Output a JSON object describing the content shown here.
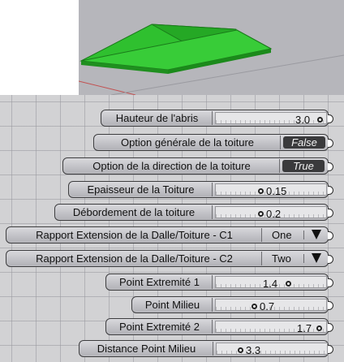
{
  "viewport": {
    "roof_color": "#2ec82e",
    "background": "#b6b6bb"
  },
  "params": [
    {
      "type": "slider",
      "label": "Hauteur de l'abris",
      "value": "3.0",
      "fraction": 0.95
    },
    {
      "type": "toggle",
      "label": "Option générale de la toiture",
      "value": "False"
    },
    {
      "type": "toggle",
      "label": "Option de la direction de la toiture",
      "value": "True"
    },
    {
      "type": "slider",
      "label": "Epaisseur de la Toiture",
      "value": "0.15",
      "fraction": 0.3
    },
    {
      "type": "slider",
      "label": "Débordement de la toiture",
      "value": "0.2",
      "fraction": 0.35
    },
    {
      "type": "dropdown",
      "label": "Rapport Extension de la Dalle/Toiture - C1",
      "value": "One"
    },
    {
      "type": "dropdown",
      "label": "Rapport Extension de la Dalle/Toiture - C2",
      "value": "Two"
    },
    {
      "type": "slider",
      "label": "Point Extremité 1",
      "value": "1.4",
      "fraction": 0.65
    },
    {
      "type": "slider",
      "label": "Point Milieu",
      "value": "0.7",
      "fraction": 0.35
    },
    {
      "type": "slider",
      "label": "Point Extremité 2",
      "value": "1.7",
      "fraction": 0.9
    },
    {
      "type": "slider",
      "label": "Distance Point Milieu",
      "value": "3.3",
      "fraction": 0.2
    }
  ]
}
